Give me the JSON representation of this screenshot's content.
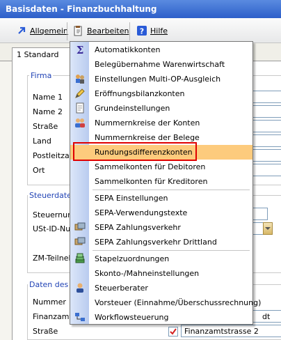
{
  "window": {
    "title": "Basisdaten - Finanzbuchhaltung"
  },
  "menubar": {
    "allgemein": "Allgemein",
    "bearbeiten": "Bearbeiten",
    "hilfe": "Hilfe"
  },
  "tabs": [
    "1 Standard"
  ],
  "groups": {
    "firma": {
      "title": "Firma",
      "labels": [
        "Name 1",
        "Name 2",
        "Straße",
        "Land",
        "Postleitzah",
        "Ort"
      ]
    },
    "steuer": {
      "title": "Steuerdater",
      "labels": [
        "Steuernum",
        "USt-ID-Nu",
        "ZM-Teilneh"
      ]
    },
    "daten": {
      "title": "Daten des z",
      "labels": [
        "Nummer",
        "Finanzamt",
        "Straße"
      ]
    }
  },
  "background_fields": {
    "finanzamt_tail": "dt",
    "strasse_value": "Finanzamtstrasse 2"
  },
  "dropdown": {
    "items": [
      {
        "label": "Automatikkonten",
        "icon": "sigma-icon"
      },
      {
        "label": "Belegübernahme Warenwirtschaft",
        "icon": ""
      },
      {
        "label": "Einstellungen Multi-OP-Ausgleich",
        "icon": "users-settings-icon"
      },
      {
        "label": "Eröffnungsbilanzkonten",
        "icon": "pencil-icon"
      },
      {
        "label": "Grundeinstellungen",
        "icon": "document-icon"
      },
      {
        "label": "Nummernkreise der Konten",
        "icon": "people-icon"
      },
      {
        "label": "Nummernkreise der Belege",
        "icon": ""
      },
      {
        "label": "Rundungsdifferenzkonten",
        "icon": ""
      },
      {
        "label": "Sammelkonten für Debitoren",
        "icon": ""
      },
      {
        "label": "Sammelkonten für Kreditoren",
        "icon": ""
      },
      {
        "label": "SEPA Einstellungen",
        "icon": ""
      },
      {
        "label": "SEPA-Verwendungstexte",
        "icon": ""
      },
      {
        "label": "SEPA Zahlungsverkehr",
        "icon": "sepa-transfer-icon"
      },
      {
        "label": "SEPA Zahlungsverkehr Drittland",
        "icon": "sepa-transfer-icon"
      },
      {
        "label": "Stapelzuordnungen",
        "icon": "stack-icon"
      },
      {
        "label": "Skonto-/Mahneinstellungen",
        "icon": ""
      },
      {
        "label": "Steuerberater",
        "icon": "advisor-icon"
      },
      {
        "label": "Vorsteuer (Einnahme/Überschussrechnung)",
        "icon": ""
      },
      {
        "label": "Workflowsteuerung",
        "icon": "workflow-icon"
      }
    ],
    "highlighted": "Rundungsdifferenzkonten"
  }
}
